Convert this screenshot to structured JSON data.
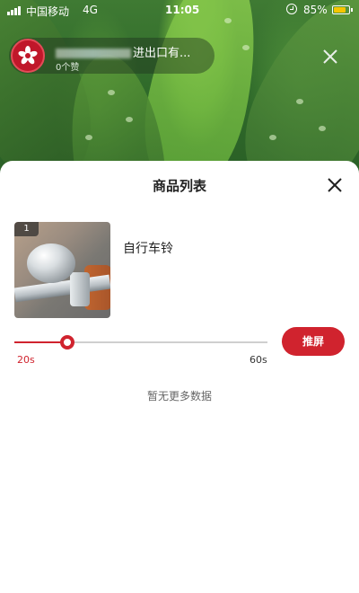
{
  "status_bar": {
    "carrier": "中国移动",
    "network": "4G",
    "time": "11:05",
    "battery_percent": "85%",
    "battery_level": 0.85,
    "battery_color": "#f6c500"
  },
  "room": {
    "title_suffix": "进出口有...",
    "likes": "0个赞",
    "avatar_icon": "flower-logo-icon",
    "close_icon": "close-icon"
  },
  "sheet": {
    "title": "商品列表",
    "close_icon": "close-icon",
    "products": [
      {
        "index": "1",
        "name": "自行车铃",
        "image_icon": "bicycle-bell-image"
      }
    ],
    "slider": {
      "min_label": "20s",
      "max_label": "60s",
      "value": 0.2
    },
    "push_button": "推屏",
    "empty_text": "暂无更多数据"
  },
  "colors": {
    "accent": "#d0232e",
    "sheet_bg": "#ffffff"
  }
}
